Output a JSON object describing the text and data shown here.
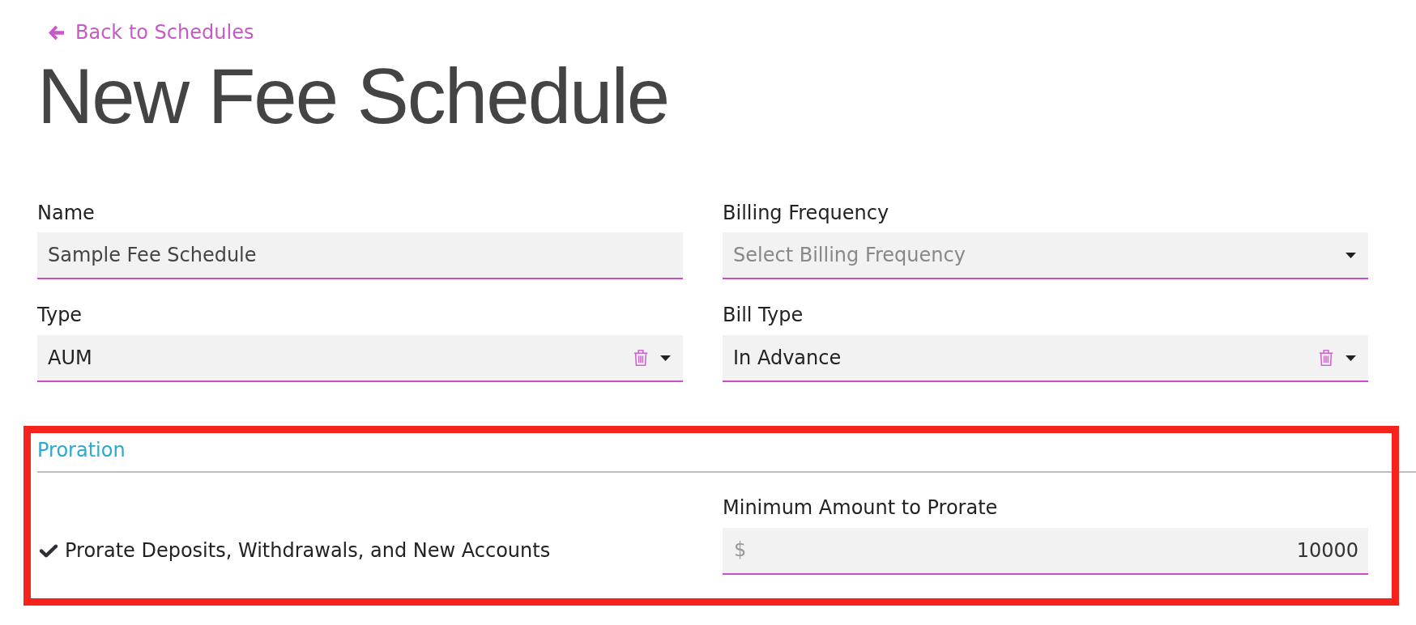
{
  "back_link": {
    "label": "Back to Schedules"
  },
  "title": "New Fee Schedule",
  "fields": [
    {
      "kind": "text",
      "label": "Name",
      "value": "Sample Fee Schedule"
    },
    {
      "kind": "select",
      "label": "Billing Frequency",
      "placeholder": "Select Billing Frequency",
      "clearable": false
    },
    {
      "kind": "select",
      "label": "Type",
      "value": "AUM",
      "clearable": true
    },
    {
      "kind": "select",
      "label": "Bill Type",
      "value": "In Advance",
      "clearable": true
    }
  ],
  "proration": {
    "title": "Proration",
    "highlighted": true,
    "checkbox": {
      "label": "Prorate Deposits, Withdrawals, and New Accounts",
      "checked": true
    },
    "amount_field": {
      "label": "Minimum Amount to Prorate",
      "prefix": "$",
      "value": "10000"
    }
  }
}
